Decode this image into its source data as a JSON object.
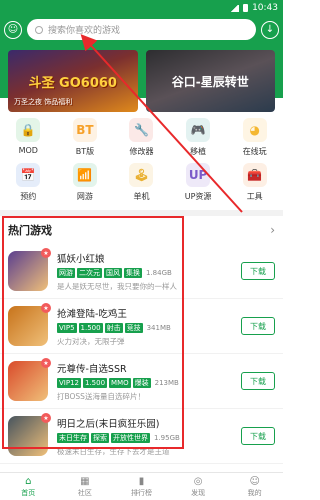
{
  "statusbar": {
    "time": "10:43"
  },
  "search": {
    "placeholder": "搜索你喜欢的游戏"
  },
  "banners": [
    {
      "title": "斗圣 GO6060",
      "subtitle": "万圣之夜 饰品福利"
    },
    {
      "title": "谷口-星辰转世",
      "subtitle": ""
    }
  ],
  "categories": [
    {
      "label": "MOD",
      "icon": "lock-icon",
      "color": "#33b24f",
      "glyph": "🔒"
    },
    {
      "label": "BT版",
      "icon": "bt-icon",
      "color": "#f6a12a",
      "glyph": "BT"
    },
    {
      "label": "修改器",
      "icon": "wrench-icon",
      "color": "#e35b4b",
      "glyph": "🔧"
    },
    {
      "label": "移植",
      "icon": "gamepad-icon",
      "color": "#2f9b93",
      "glyph": "🎮"
    },
    {
      "label": "在线玩",
      "icon": "pacman-icon",
      "color": "#f4b731",
      "glyph": "◕"
    },
    {
      "label": "预约",
      "icon": "calendar-icon",
      "color": "#3c7bd6",
      "glyph": "📅"
    },
    {
      "label": "网游",
      "icon": "signal-icon",
      "color": "#2db06c",
      "glyph": "📶"
    },
    {
      "label": "单机",
      "icon": "joystick-icon",
      "color": "#e9b032",
      "glyph": "🕹"
    },
    {
      "label": "UP资源",
      "icon": "up-icon",
      "color": "#7c5ac9",
      "glyph": "UP"
    },
    {
      "label": "工具",
      "icon": "toolbox-icon",
      "color": "#f08a34",
      "glyph": "🧰"
    }
  ],
  "hot_games": {
    "title": "热门游戏",
    "download_label": "下载",
    "items": [
      {
        "name": "狐妖小红娘",
        "tags": [
          "网游",
          "二次元",
          "国风",
          "集换"
        ],
        "size": "1.84GB",
        "desc": "是人是妖无尽世，我只要你的一样人",
        "color": "#5b3f8f"
      },
      {
        "name": "抢滩登陆-吃鸡王",
        "tags": [
          "VIP5",
          "1.500",
          "射击",
          "竞技"
        ],
        "size": "341MB",
        "desc": "火力对决，无限子弹",
        "color": "#c7731b"
      },
      {
        "name": "元尊传-自选SSR",
        "tags": [
          "VIP12",
          "1.500",
          "MMO",
          "爆装"
        ],
        "size": "213MB",
        "desc": "打BOSS送海量自选碎片！",
        "color": "#d94b2b"
      },
      {
        "name": "明日之后(末日疯狂乐园)",
        "tags": [
          "末日生存",
          "探索",
          "开放性世界"
        ],
        "size": "1.95GB",
        "desc": "极速末日生存，生存下去才是王道",
        "color": "#47545e"
      }
    ]
  },
  "bottom_nav": [
    {
      "label": "首页",
      "icon": "home-icon",
      "glyph": "⌂"
    },
    {
      "label": "社区",
      "icon": "community-icon",
      "glyph": "▦"
    },
    {
      "label": "排行榜",
      "icon": "ranking-icon",
      "glyph": "▮"
    },
    {
      "label": "发现",
      "icon": "discover-icon",
      "glyph": "◎"
    },
    {
      "label": "我的",
      "icon": "user-icon",
      "glyph": "☺"
    }
  ]
}
